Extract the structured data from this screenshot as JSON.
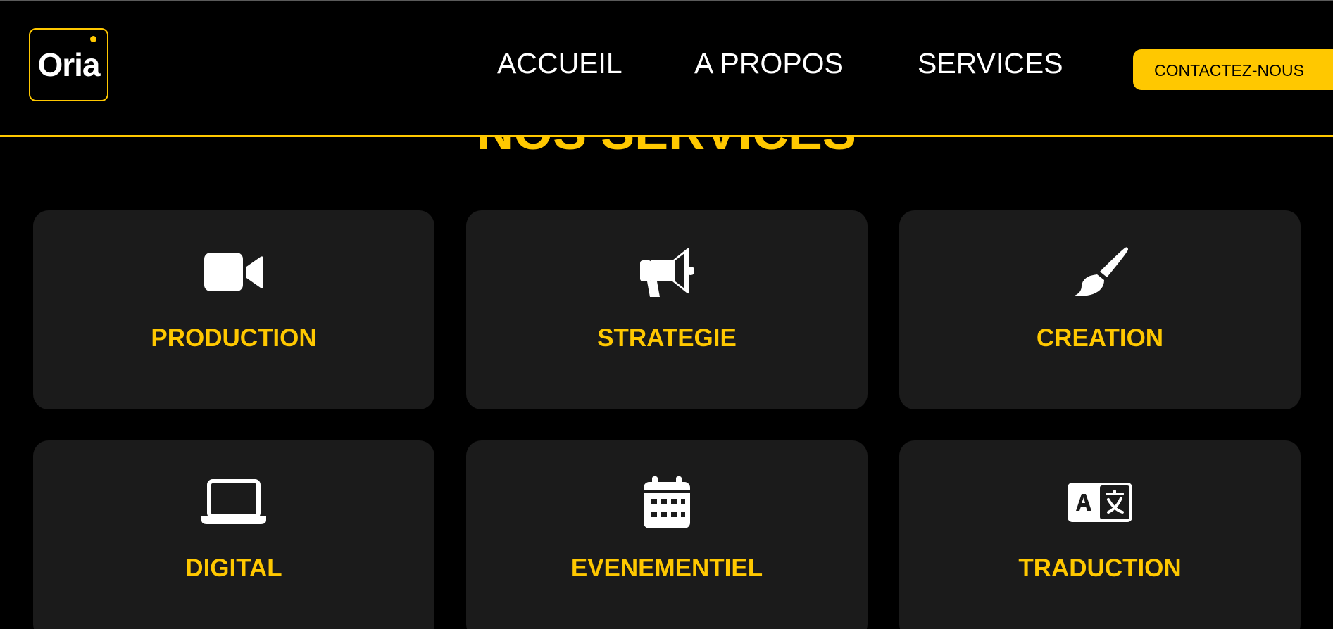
{
  "header": {
    "logo_text": "Oria",
    "nav": [
      {
        "label": "ACCUEIL"
      },
      {
        "label": "A PROPOS"
      },
      {
        "label": "SERVICES"
      }
    ],
    "contact_label": "CONTACTEZ-NOUS"
  },
  "section": {
    "title": "NOS SERVICES"
  },
  "services": [
    {
      "label": "PRODUCTION",
      "icon": "video-camera-icon"
    },
    {
      "label": "STRATEGIE",
      "icon": "megaphone-icon"
    },
    {
      "label": "CREATION",
      "icon": "paintbrush-icon"
    },
    {
      "label": "DIGITAL",
      "icon": "laptop-icon"
    },
    {
      "label": "EVENEMENTIEL",
      "icon": "calendar-icon"
    },
    {
      "label": "TRADUCTION",
      "icon": "language-icon"
    }
  ],
  "colors": {
    "accent": "#FFC800",
    "background": "#000000",
    "card": "#1b1b1b",
    "text": "#ffffff"
  }
}
